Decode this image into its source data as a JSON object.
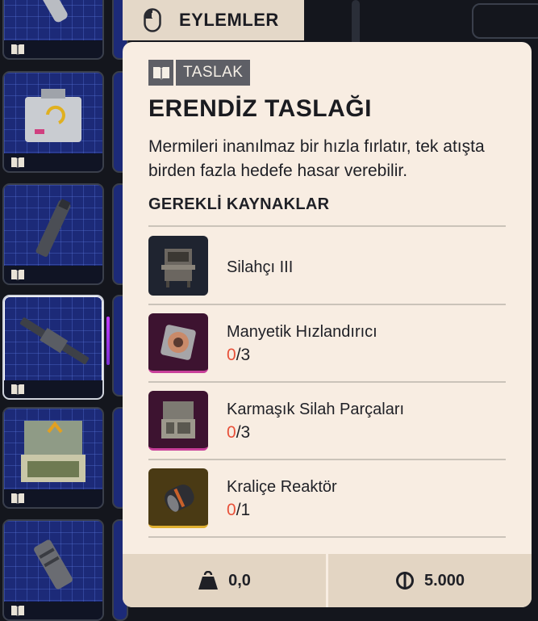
{
  "actions_tab": {
    "label": "EYLEMLER",
    "icon": "mouse-icon"
  },
  "tooltip": {
    "badge": {
      "icon": "book-icon",
      "label": "TASLAK"
    },
    "title": "ERENDİZ TASLAĞI",
    "description": "Mermileri inanılmaz bir hızla fırlatır, tek atışta birden fazla hedefe hasar verebilir.",
    "required_header": "GEREKLİ KAYNAKLAR",
    "requirements": [
      {
        "name": "Silahçı III",
        "thumb": "workbench-icon",
        "bg": "#1f2430"
      },
      {
        "name": "Manyetik Hızlandırıcı",
        "have": "0",
        "need": "/3",
        "thumb": "coil-icon",
        "bg": "#3d1330"
      },
      {
        "name": "Karmaşık Silah Parçaları",
        "have": "0",
        "need": "/3",
        "thumb": "weapon-parts-icon",
        "bg": "#3d1330"
      },
      {
        "name": "Kraliçe Reaktör",
        "have": "0",
        "need": "/1",
        "thumb": "reactor-icon",
        "bg": "#4a3a14"
      }
    ],
    "footer": {
      "weight": "0,0",
      "weight_icon": "weight-icon",
      "price": "5.000",
      "price_icon": "coin-icon"
    }
  },
  "colors": {
    "panel_bg": "#f8ede2",
    "missing_count": "#e8513a",
    "badge_bg": "#5e5f66",
    "slot_bg": "#1c2a78"
  }
}
